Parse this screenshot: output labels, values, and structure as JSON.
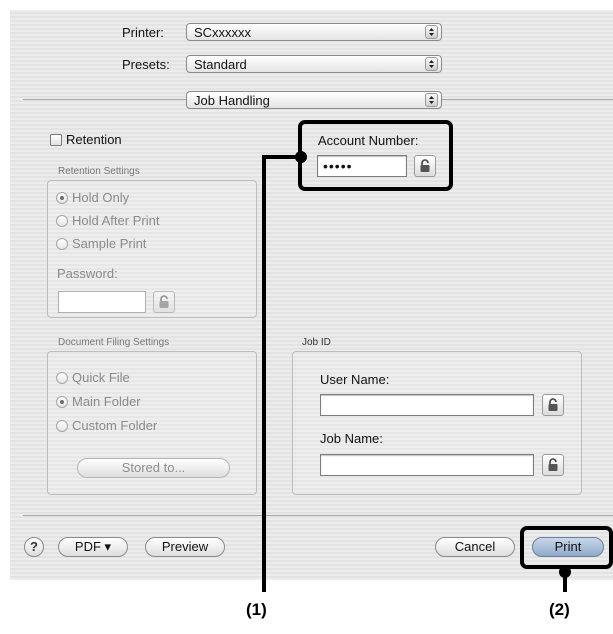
{
  "printer": {
    "label": "Printer:",
    "value": "SCxxxxxx"
  },
  "presets": {
    "label": "Presets:",
    "value": "Standard"
  },
  "section_popup": {
    "value": "Job Handling"
  },
  "retention": {
    "checkbox_label": "Retention",
    "settings_title": "Retention Settings",
    "options": [
      "Hold Only",
      "Hold After Print",
      "Sample Print"
    ],
    "selected": "Hold Only",
    "password_label": "Password:"
  },
  "account": {
    "label": "Account Number:",
    "value": "•••••"
  },
  "document_filing": {
    "title": "Document Filing Settings",
    "options": [
      "Quick File",
      "Main Folder",
      "Custom Folder"
    ],
    "selected": "Main Folder",
    "stored_to_label": "Stored to..."
  },
  "job_id": {
    "title": "Job ID",
    "user_name_label": "User Name:",
    "job_name_label": "Job Name:"
  },
  "footer": {
    "help": "?",
    "pdf_label": "PDF ▾",
    "preview_label": "Preview",
    "cancel_label": "Cancel",
    "print_label": "Print"
  },
  "annotations": {
    "callout1": "(1)",
    "callout2": "(2)"
  },
  "colors": {
    "callout": "#000000",
    "default_button": "#8fa9c8"
  },
  "icons": [
    "popup-arrows-icon",
    "lock-icon",
    "help-icon"
  ]
}
